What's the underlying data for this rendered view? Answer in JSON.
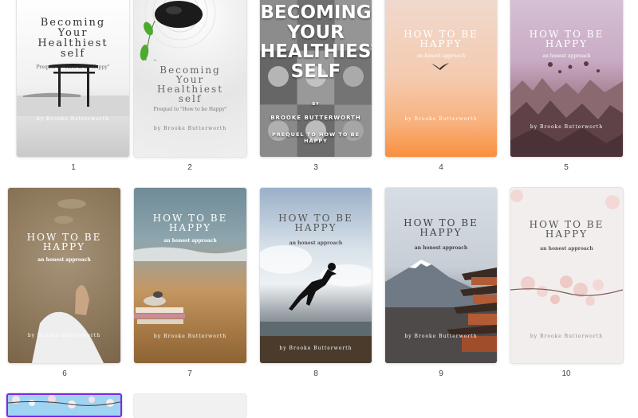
{
  "pages": [
    {
      "number": "1",
      "title_lines": [
        "Becoming",
        "Your",
        "Healthiest",
        "self"
      ],
      "subtitle": "Prequel to \"How to be Happy\"",
      "author": "by Brooke Butterworth"
    },
    {
      "number": "2",
      "title_lines": [
        "Becoming",
        "Your",
        "Healthiest",
        "self"
      ],
      "subtitle": "Prequel to \"How to be Happy\"",
      "author": "by Brooke Butterworth"
    },
    {
      "number": "3",
      "title_lines": [
        "BECOMING",
        "YOUR",
        "HEALTHIEST",
        "SELF"
      ],
      "small_word": "BY",
      "author": "BROOKE BUTTERWORTH",
      "subtitle": "PREQUEL TO HOW TO BE HAPPY"
    },
    {
      "number": "4",
      "title_lines": [
        "HOW TO BE",
        "HAPPY"
      ],
      "subtitle": "an honest approach",
      "author": "by Brooke Butterworth"
    },
    {
      "number": "5",
      "title_lines": [
        "HOW TO BE",
        "HAPPY"
      ],
      "subtitle": "an honest approach",
      "author": "by Brooke Butterworth"
    },
    {
      "number": "6",
      "title_lines": [
        "HOW TO BE",
        "HAPPY"
      ],
      "subtitle": "an honest approach",
      "author": "by Brooke Butterworth"
    },
    {
      "number": "7",
      "title_lines": [
        "HOW TO BE",
        "HAPPY"
      ],
      "subtitle": "an honest approach",
      "author": "by Brooke Butterworth"
    },
    {
      "number": "8",
      "title_lines": [
        "HOW TO BE",
        "HAPPY"
      ],
      "subtitle": "an honest approach",
      "author": "by Brooke Butterworth"
    },
    {
      "number": "9",
      "title_lines": [
        "HOW TO BE",
        "HAPPY"
      ],
      "subtitle": "an honest approach",
      "author": "by Brooke Butterworth"
    },
    {
      "number": "10",
      "title_lines": [
        "HOW TO BE",
        "HAPPY"
      ],
      "subtitle": "an honest approach",
      "author": "by Brooke Butterworth"
    }
  ],
  "colors": {
    "selection_outline": "#7d2ae8",
    "card_border": "#e4e4e4",
    "page_number": "#444444"
  }
}
